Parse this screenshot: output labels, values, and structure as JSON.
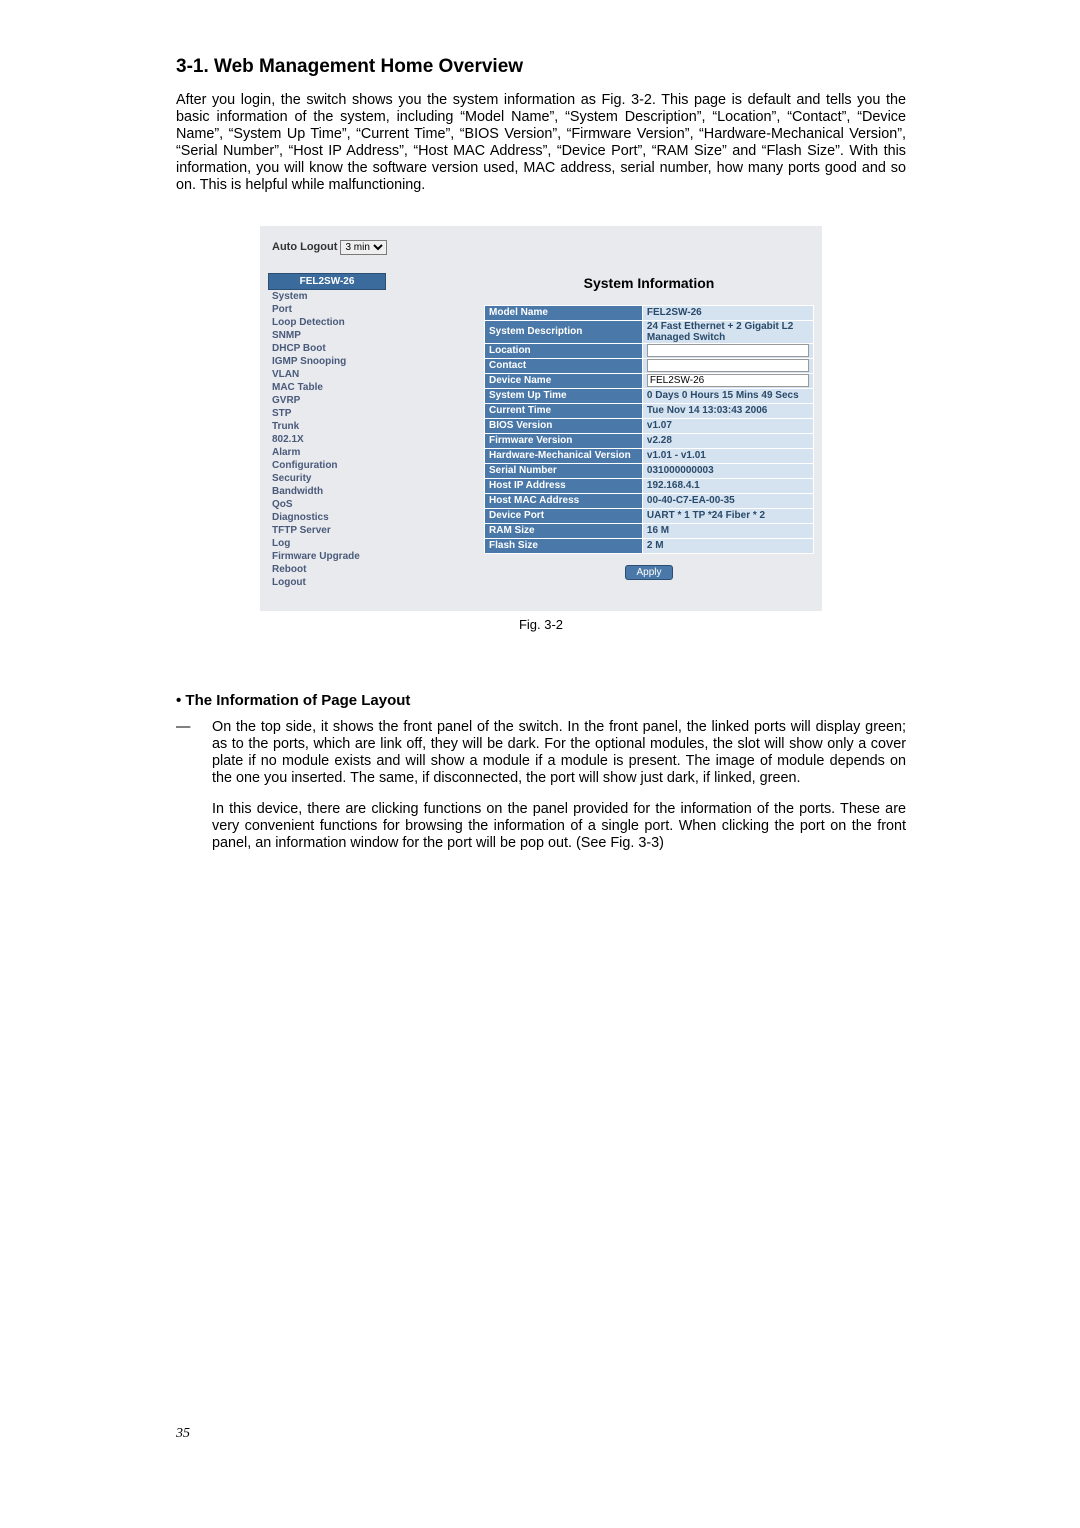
{
  "section_title": "3-1. Web Management Home Overview",
  "intro": "After you login, the switch shows you the system information as Fig. 3-2. This page is default and tells you the basic information of the system, including “Model Name”, “System Description”, “Location”, “Contact”, “Device Name”, “System Up Time”, “Current Time”, “BIOS Version”, “Firmware Version”, “Hardware-Mechanical Version”, “Serial Number”, “Host IP Address”, “Host MAC Address”, “Device Port”, “RAM Size” and “Flash Size”. With this information, you will know the software version used, MAC address, serial number, how many ports good and so on. This is helpful while malfunctioning.",
  "auto_logout_label": "Auto Logout",
  "auto_logout_value": "3 min",
  "sidebar": {
    "head": "FEL2SW-26",
    "items": [
      "System",
      "Port",
      "Loop Detection",
      "SNMP",
      "DHCP Boot",
      "IGMP Snooping",
      "VLAN",
      "MAC Table",
      "GVRP",
      "STP",
      "Trunk",
      "802.1X",
      "Alarm",
      "Configuration",
      "Security",
      "Bandwidth",
      "QoS",
      "Diagnostics",
      "TFTP Server",
      "Log",
      "Firmware Upgrade",
      "Reboot",
      "Logout"
    ]
  },
  "panel_title": "System Information",
  "rows": [
    {
      "label": "Model Name",
      "value": "FEL2SW-26"
    },
    {
      "label": "System Description",
      "value": "24 Fast Ethernet + 2 Gigabit L2 Managed Switch"
    },
    {
      "label": "Location",
      "value": "",
      "input": true
    },
    {
      "label": "Contact",
      "value": "",
      "input": true
    },
    {
      "label": "Device Name",
      "value": "FEL2SW-26",
      "input": true
    },
    {
      "label": "System Up Time",
      "value": "0 Days 0 Hours 15 Mins 49 Secs"
    },
    {
      "label": "Current Time",
      "value": "Tue Nov 14 13:03:43 2006"
    },
    {
      "label": "BIOS Version",
      "value": "v1.07"
    },
    {
      "label": "Firmware Version",
      "value": "v2.28"
    },
    {
      "label": "Hardware-Mechanical Version",
      "value": "v1.01 - v1.01"
    },
    {
      "label": "Serial Number",
      "value": "031000000003"
    },
    {
      "label": "Host IP Address",
      "value": "192.168.4.1"
    },
    {
      "label": "Host MAC Address",
      "value": "00-40-C7-EA-00-35"
    },
    {
      "label": "Device Port",
      "value": "UART * 1 TP *24 Fiber * 2"
    },
    {
      "label": "RAM Size",
      "value": "16 M"
    },
    {
      "label": "Flash Size",
      "value": "2 M"
    }
  ],
  "apply_label": "Apply",
  "fig_caption": "Fig. 3-2",
  "sub_title_prefix": "• ",
  "sub_title": "The Information of Page Layout",
  "dash": "—",
  "para1": "On the top side, it shows the front panel of the switch. In the front panel, the linked ports will display green; as to the ports, which are link off, they will be dark. For the optional modules, the slot will show only a cover plate if no module exists and will show a module if a module is present. The image of module depends on the one you inserted. The same, if disconnected, the port will show just dark, if linked, green.",
  "para2": "In this device, there are clicking functions on the panel provided for the information of the ports. These are very convenient functions for browsing the information of a single port. When clicking the port on the front panel, an information window for the port will be pop out. (See Fig. 3-3)",
  "pagenum": "35"
}
